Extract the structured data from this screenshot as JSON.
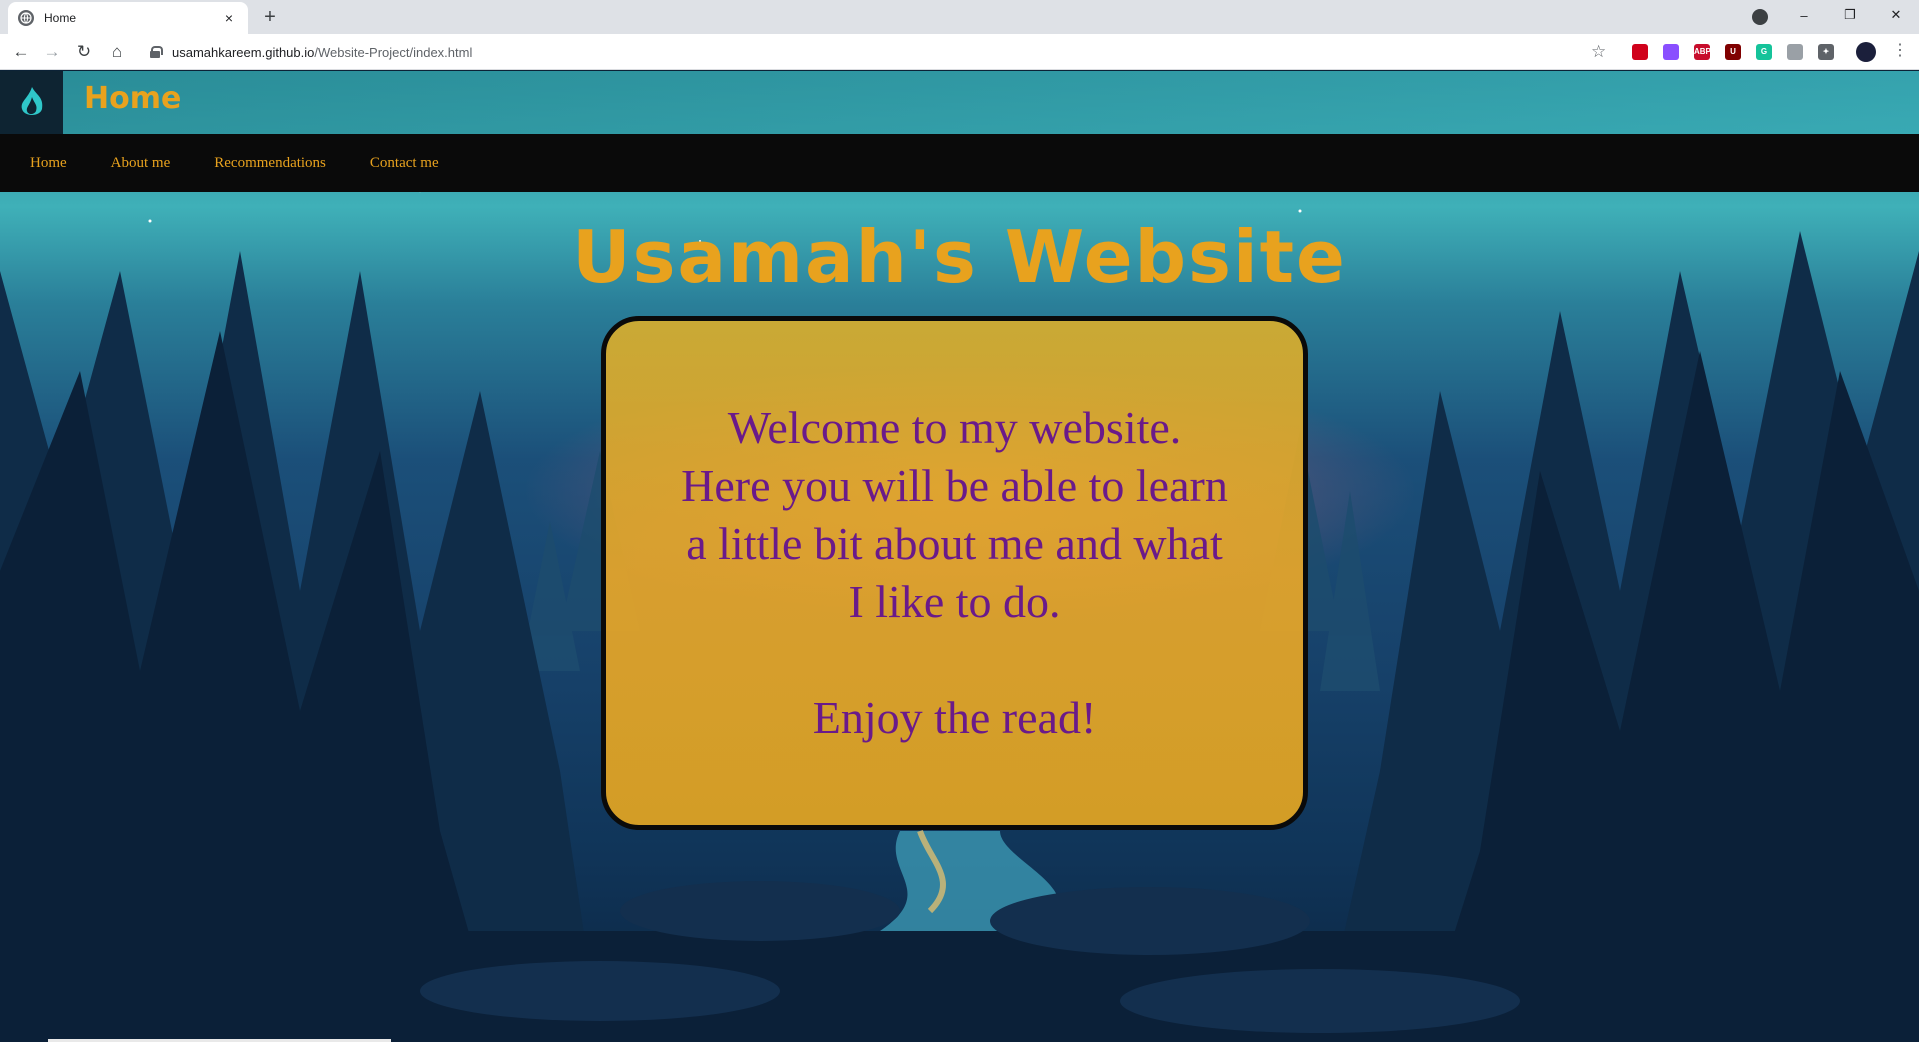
{
  "browser": {
    "tab_title": "Home",
    "tab_close": "×",
    "new_tab": "+",
    "url_host": "usamahkareem.github.io",
    "url_path": "/Website-Project/index.html",
    "window_controls": [
      "–",
      "❐",
      "✕"
    ],
    "nav": {
      "back": "←",
      "forward": "→",
      "reload": "↻",
      "home": "⌂"
    },
    "star": "☆",
    "extensions": [
      {
        "name": "opera-icon",
        "label": "",
        "color": "#d0021b"
      },
      {
        "name": "pen-icon",
        "label": "",
        "color": "#8a4fff"
      },
      {
        "name": "adblock-plus-icon",
        "label": "ABP",
        "color": "#c70d2c"
      },
      {
        "name": "ublock-icon",
        "label": "U",
        "color": "#800000"
      },
      {
        "name": "grammarly-icon",
        "label": "G",
        "color": "#15c39a"
      },
      {
        "name": "reader-icon",
        "label": "",
        "color": "#9aa0a6"
      },
      {
        "name": "extensions-puzzle-icon",
        "label": "✦",
        "color": "#5f6368"
      }
    ],
    "menu": "⋮"
  },
  "site": {
    "header_title": "Home",
    "nav": [
      {
        "label": "Home"
      },
      {
        "label": "About me"
      },
      {
        "label": "Recommendations"
      },
      {
        "label": "Contact me"
      }
    ],
    "title": "Usamah's Website",
    "welcome_lines": [
      "Welcome to my website.",
      "Here you will be able to learn",
      "a little bit about me and what",
      "I like to do."
    ],
    "closing": "Enjoy the read!"
  },
  "colors": {
    "accent_orange": "#e8a21e",
    "card_fill": "#e6ac28",
    "card_text_purple": "#6a1a8a",
    "nav_bg": "#0a0a0a"
  }
}
